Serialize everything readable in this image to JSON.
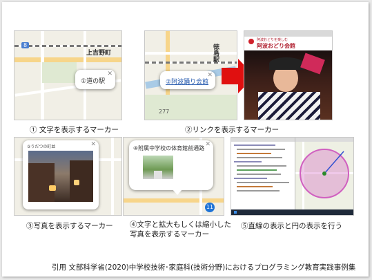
{
  "panels": {
    "p1": {
      "caption": "① 文字を表示するマーカー",
      "popup_text": "①道の駅",
      "map_labels": [
        "上吉野町",
        "8"
      ]
    },
    "p2": {
      "caption": "②リンクを表示するマーカー",
      "popup_link": "②阿波踊り会館",
      "map_labels": [
        "徳島駅",
        "277"
      ],
      "site_title": "阿波おどり会館",
      "site_tagline": "阿波おどりを楽しむ"
    },
    "p3": {
      "caption": "③写真を表示するマーカー",
      "popup_title": "③うだつの町並"
    },
    "p4": {
      "caption_line1": "④文字と拡大もしくは縮小した",
      "caption_line2": "写真を表示するマーカー",
      "popup_title": "④附属中学校の体育館前通路",
      "route_badge": "11"
    },
    "p5": {
      "caption": "⑤直線の表示と円の表示を行う"
    }
  },
  "footer": "引用 文部科学省(2020)中学校技術･家庭科(技術分野)におけるプログラミング教育実践事例集",
  "colors": {
    "arrow": "#e01010",
    "link": "#2a5db0",
    "circle": "#d060c0",
    "badge": "#1e73d6"
  }
}
